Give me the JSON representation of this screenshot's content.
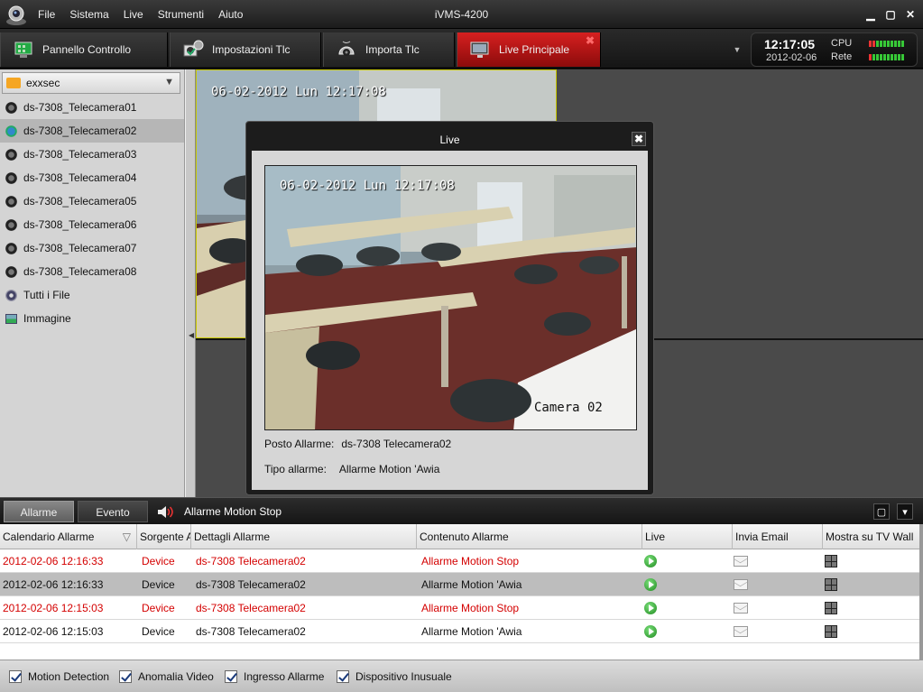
{
  "app": {
    "title": "iVMS-4200"
  },
  "menu": [
    "File",
    "Sistema",
    "Live",
    "Strumenti",
    "Aiuto"
  ],
  "tabs": [
    {
      "label": "Pannello Controllo"
    },
    {
      "label": "Impostazioni Tlc"
    },
    {
      "label": "Importa Tlc"
    },
    {
      "label": "Live Principale",
      "close": "✖"
    }
  ],
  "status": {
    "time": "12:17:05",
    "date": "2012-02-06",
    "cpu_label": "CPU",
    "net_label": "Rete"
  },
  "sidebar": {
    "group": "exxsec",
    "items": [
      {
        "label": "ds-7308_Telecamera01"
      },
      {
        "label": "ds-7308_Telecamera02"
      },
      {
        "label": "ds-7308_Telecamera03"
      },
      {
        "label": "ds-7308_Telecamera04"
      },
      {
        "label": "ds-7308_Telecamera05"
      },
      {
        "label": "ds-7308_Telecamera06"
      },
      {
        "label": "ds-7308_Telecamera07"
      },
      {
        "label": "ds-7308_Telecamera08"
      },
      {
        "label": "Tutti i File"
      },
      {
        "label": "Immagine"
      }
    ]
  },
  "video": {
    "timestamp": "06-02-2012 Lun 12:17:08",
    "camera_label": "Camera 02"
  },
  "popup": {
    "title": "Live",
    "close": "✖",
    "alarm_place_label": "Posto Allarme:",
    "alarm_place_value": "ds-7308 Telecamera02",
    "alarm_type_label": "Tipo allarme:",
    "alarm_type_value": "Allarme Motion 'Awia"
  },
  "alarm_panel": {
    "tabs": [
      "Allarme",
      "Evento"
    ],
    "message": "Allarme Motion Stop",
    "columns": [
      "Calendario Allarme",
      "Sorgente Allarme",
      "Dettagli Allarme",
      "Contenuto Allarme",
      "Live",
      "Invia Email",
      "Mostra su TV Wall"
    ],
    "rows": [
      {
        "time": "2012-02-06 12:16:33",
        "source": "Device",
        "details": "ds-7308 Telecamera02",
        "content": "Allarme Motion Stop"
      },
      {
        "time": "2012-02-06 12:16:33",
        "source": "Device",
        "details": "ds-7308 Telecamera02",
        "content": "Allarme Motion 'Awia"
      },
      {
        "time": "2012-02-06 12:15:03",
        "source": "Device",
        "details": "ds-7308 Telecamera02",
        "content": "Allarme Motion Stop"
      },
      {
        "time": "2012-02-06 12:15:03",
        "source": "Device",
        "details": "ds-7308 Telecamera02",
        "content": "Allarme Motion 'Awia"
      }
    ]
  },
  "filters": [
    {
      "label": "Motion Detection",
      "checked": true
    },
    {
      "label": "Anomalia Video",
      "checked": true
    },
    {
      "label": "Ingresso Allarme",
      "checked": true
    },
    {
      "label": "Dispositivo Inusuale",
      "checked": true
    }
  ],
  "colors": {
    "accent_red": "#c81414",
    "alarm_text_red": "#d40000",
    "status_green": "#37c837"
  },
  "icons": [
    "app-logo-icon",
    "control-panel-icon",
    "settings-icon",
    "import-icon",
    "monitor-icon",
    "folder-icon",
    "camera-icon",
    "files-icon",
    "image-icon",
    "speaker-icon",
    "play-icon",
    "mail-icon",
    "tv-wall-icon"
  ]
}
